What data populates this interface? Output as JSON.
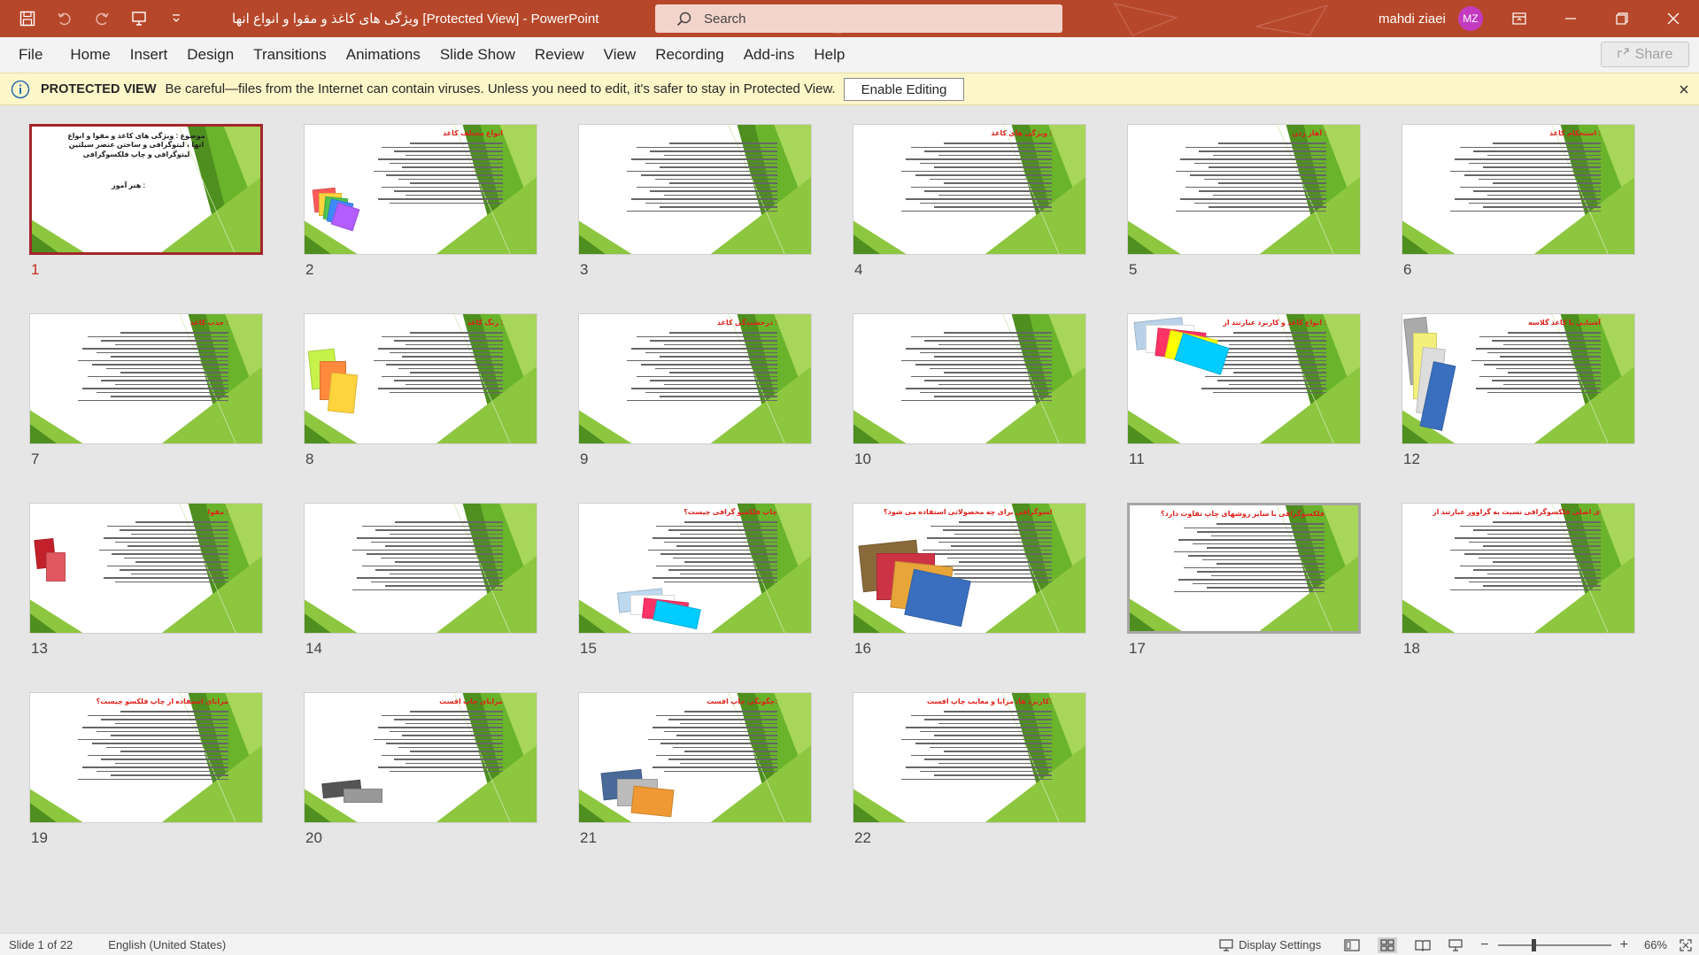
{
  "window": {
    "title": "ویژگی های کاغذ و مقوا و انواع انها  [Protected View]  -  PowerPoint",
    "search_placeholder": "Search",
    "user_name": "mahdi ziaei",
    "user_initials": "MZ"
  },
  "ribbon": {
    "tabs": [
      "File",
      "Home",
      "Insert",
      "Design",
      "Transitions",
      "Animations",
      "Slide Show",
      "Review",
      "View",
      "Recording",
      "Add-ins",
      "Help"
    ],
    "share_label": "Share"
  },
  "protected_view": {
    "label": "PROTECTED VIEW",
    "message": "Be careful—files from the Internet can contain viruses. Unless you need to edit, it's safer to stay in Protected View.",
    "button": "Enable Editing"
  },
  "slides": [
    {
      "number": "1",
      "title": "موضوع : ویژگی های کاغذ و مقوا و انواع انها ، لیتوگرافی و ساختن عنصر سیلتین لیتوگرافی و چاپ فلکسوگرافی",
      "subtitle": "هنر آموز :",
      "selected": true
    },
    {
      "number": "2",
      "title": "انواع مختلف کاغذ",
      "pic": "paper"
    },
    {
      "number": "3",
      "title": ""
    },
    {
      "number": "4",
      "title": "ویژگی های کاغذ :"
    },
    {
      "number": "5",
      "title": "آهار زدن :"
    },
    {
      "number": "6",
      "title": "استحکام کاغذ :"
    },
    {
      "number": "7",
      "title": "جذب کاغذ :"
    },
    {
      "number": "8",
      "title": "رنگ کاغذ :",
      "pic": "color"
    },
    {
      "number": "9",
      "title": "درخشندگی کاغذ :"
    },
    {
      "number": "10",
      "title": ""
    },
    {
      "number": "11",
      "title": "انواع کاغذ و کاربرد عبارتند از :",
      "pic": "printer"
    },
    {
      "number": "12",
      "title": "آشنایی با کاغذ گلاسه",
      "pic": "stack"
    },
    {
      "number": "13",
      "title": "مقوا :",
      "pic": "book"
    },
    {
      "number": "14",
      "title": ""
    },
    {
      "number": "15",
      "title": "چاپ فلکسو گرافی چیست؟",
      "pic": "printerwide"
    },
    {
      "number": "16",
      "title": "از چاپ فلکسوگرافی برای چه محصولاتی استفاده می شود؟",
      "pic": "products"
    },
    {
      "number": "17",
      "title": "فلکسوگرافی با سایر روشهای چاپ تفاوت دارد؟",
      "hover": true
    },
    {
      "number": "18",
      "title": "مزایای اصلی فلکسوگرافی نسبت به گراوور عبارتند از:"
    },
    {
      "number": "19",
      "title": "مزایای استفاده از چاپ فلکسو چیست؟"
    },
    {
      "number": "20",
      "title": "مزایای چاپ افست",
      "pic": "press"
    },
    {
      "number": "21",
      "title": "چگونگی چاپ افست:",
      "pic": "machine"
    },
    {
      "number": "22",
      "title": "کاربرد ها، مزایا و معایب چاپ افست:"
    }
  ],
  "status": {
    "slide_info": "Slide 1 of 22",
    "language": "English (United States)",
    "display_settings": "Display Settings",
    "zoom": "66%"
  },
  "colors": {
    "titlebar": "#b7472a",
    "accent_red": "#e0201b",
    "green_light": "#8dc63f",
    "green_dark": "#4e8f1f"
  }
}
